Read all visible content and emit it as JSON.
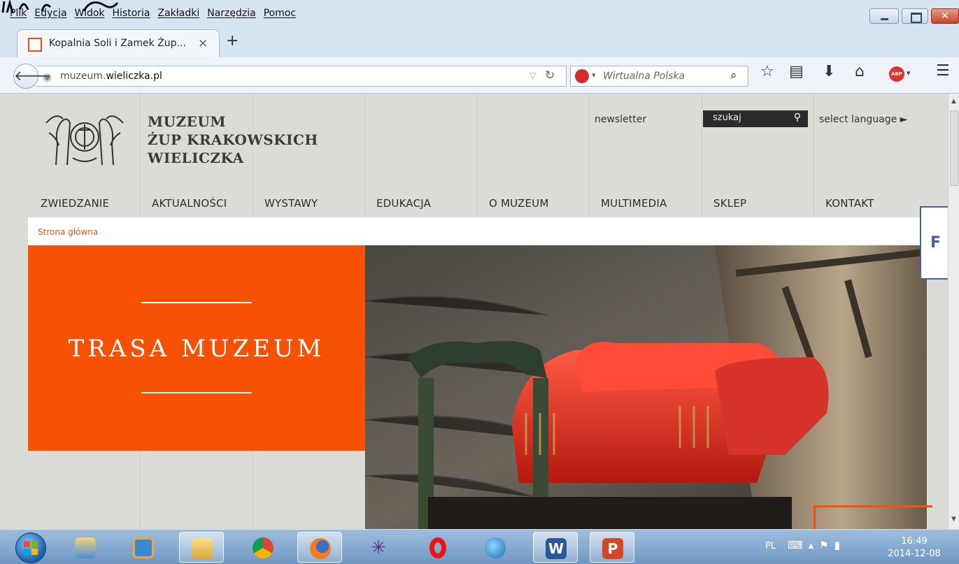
{
  "browser": {
    "menu": [
      "Plik",
      "Edycja",
      "Widok",
      "Historia",
      "Zakładki",
      "Narzędzia",
      "Pomoc"
    ],
    "tab_title": "Kopalnia Soli i Zamek Żup...",
    "tab_close": "×",
    "new_tab": "+",
    "url_host_plain": "muzeum.",
    "url_host_bold": "wieliczka.pl",
    "search_engine": "Wirtualna Polska",
    "icons": [
      "back-arrow-icon",
      "globe-icon",
      "reload-icon",
      "search-icon",
      "bookmark-star-icon",
      "reading-list-icon",
      "download-icon",
      "home-icon",
      "adblock-icon",
      "menu-icon"
    ],
    "adblock_label": "ABP"
  },
  "site": {
    "title_lines": [
      "MUZEUM",
      "ŻUP KRAKOWSKICH",
      "WIELICZKA"
    ],
    "newsletter": "newsletter",
    "search_placeholder": "szukaj",
    "select_language": "select language ►",
    "nav": [
      "ZWIEDZANIE",
      "AKTUALNOŚCI",
      "WYSTAWY",
      "EDUKACJA",
      "O MUZEUM",
      "MULTIMEDIA",
      "SKLEP",
      "KONTAKT"
    ],
    "breadcrumb": "Strona główna",
    "side_widget": "F",
    "hero_title": "TRASA MUZEUM",
    "accent_color": "#f65105"
  },
  "taskbar": {
    "apps": [
      "user-accounts-icon",
      "media-player-icon",
      "file-explorer-icon",
      "chrome-icon",
      "firefox-icon",
      "spider-icon",
      "opera-icon",
      "network-globe-icon",
      "word-icon",
      "powerpoint-icon"
    ],
    "word_letter": "W",
    "ppt_letter": "P",
    "tray_lang": "PL",
    "time": "16:49",
    "date": "2014-12-08"
  }
}
